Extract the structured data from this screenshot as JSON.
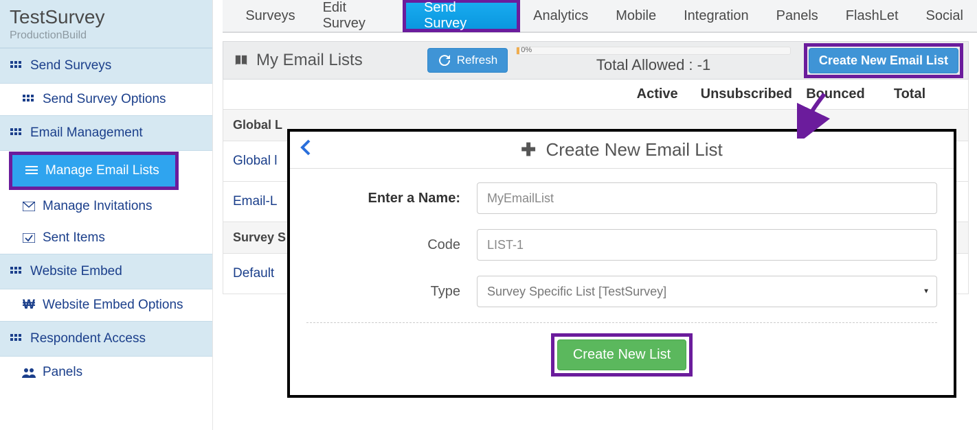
{
  "sidebar": {
    "title": "TestSurvey",
    "subtitle": "ProductionBuild",
    "sections": [
      {
        "label": "Send Surveys",
        "icon": "grid-icon"
      },
      {
        "label": "Email Management",
        "icon": "grid-icon"
      },
      {
        "label": "Website Embed",
        "icon": "grid-icon"
      },
      {
        "label": "Respondent Access",
        "icon": "grid-icon"
      }
    ],
    "items": {
      "send_survey_options": "Send Survey Options",
      "manage_email_lists": "Manage Email Lists",
      "manage_invitations": "Manage Invitations",
      "sent_items": "Sent Items",
      "website_embed_options": "Website Embed Options",
      "panels": "Panels"
    }
  },
  "topnav": [
    "Surveys",
    "Edit Survey",
    "Send Survey",
    "Analytics",
    "Mobile",
    "Integration",
    "Panels",
    "FlashLet",
    "Social"
  ],
  "page": {
    "title": "My Email Lists",
    "refresh": "Refresh",
    "progress_pct": "0%",
    "total_allowed": "Total Allowed : -1",
    "create_btn": "Create New Email List",
    "columns": [
      "Active",
      "Unsubscribed",
      "Bounced",
      "Total"
    ],
    "groups": {
      "global_lists_hdr": "Global L",
      "global_list_item": "Global l",
      "email_list_item": "Email-L",
      "survey_hdr": "Survey S",
      "default_item": "Default"
    }
  },
  "dialog": {
    "title": "Create New Email List",
    "name_label": "Enter a Name:",
    "name_value": "MyEmailList",
    "code_label": "Code",
    "code_value": "LIST-1",
    "type_label": "Type",
    "type_value": "Survey Specific List [TestSurvey]",
    "submit": "Create New List"
  }
}
